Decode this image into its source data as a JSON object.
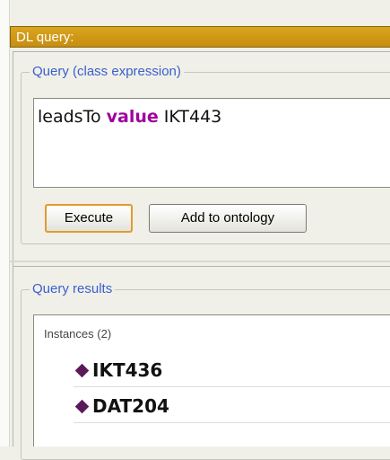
{
  "panel": {
    "title": "DL query:"
  },
  "query_section": {
    "legend": "Query (class expression)",
    "expression": {
      "part1": "leadsTo ",
      "keyword": "value",
      "part2": " IKT443"
    },
    "buttons": {
      "execute": "Execute",
      "add_to_ontology": "Add to ontology"
    }
  },
  "results_section": {
    "legend": "Query results",
    "header": "Instances (2)",
    "items": [
      {
        "label": "IKT436",
        "icon": "individual-diamond-icon"
      },
      {
        "label": "DAT204",
        "icon": "individual-diamond-icon"
      }
    ]
  },
  "colors": {
    "title_bar": "#cf961a",
    "legend_text": "#3a5fcd",
    "keyword": "#a000a0",
    "individual_icon": "#5a1a5a",
    "focus_border": "#e39a2e"
  }
}
